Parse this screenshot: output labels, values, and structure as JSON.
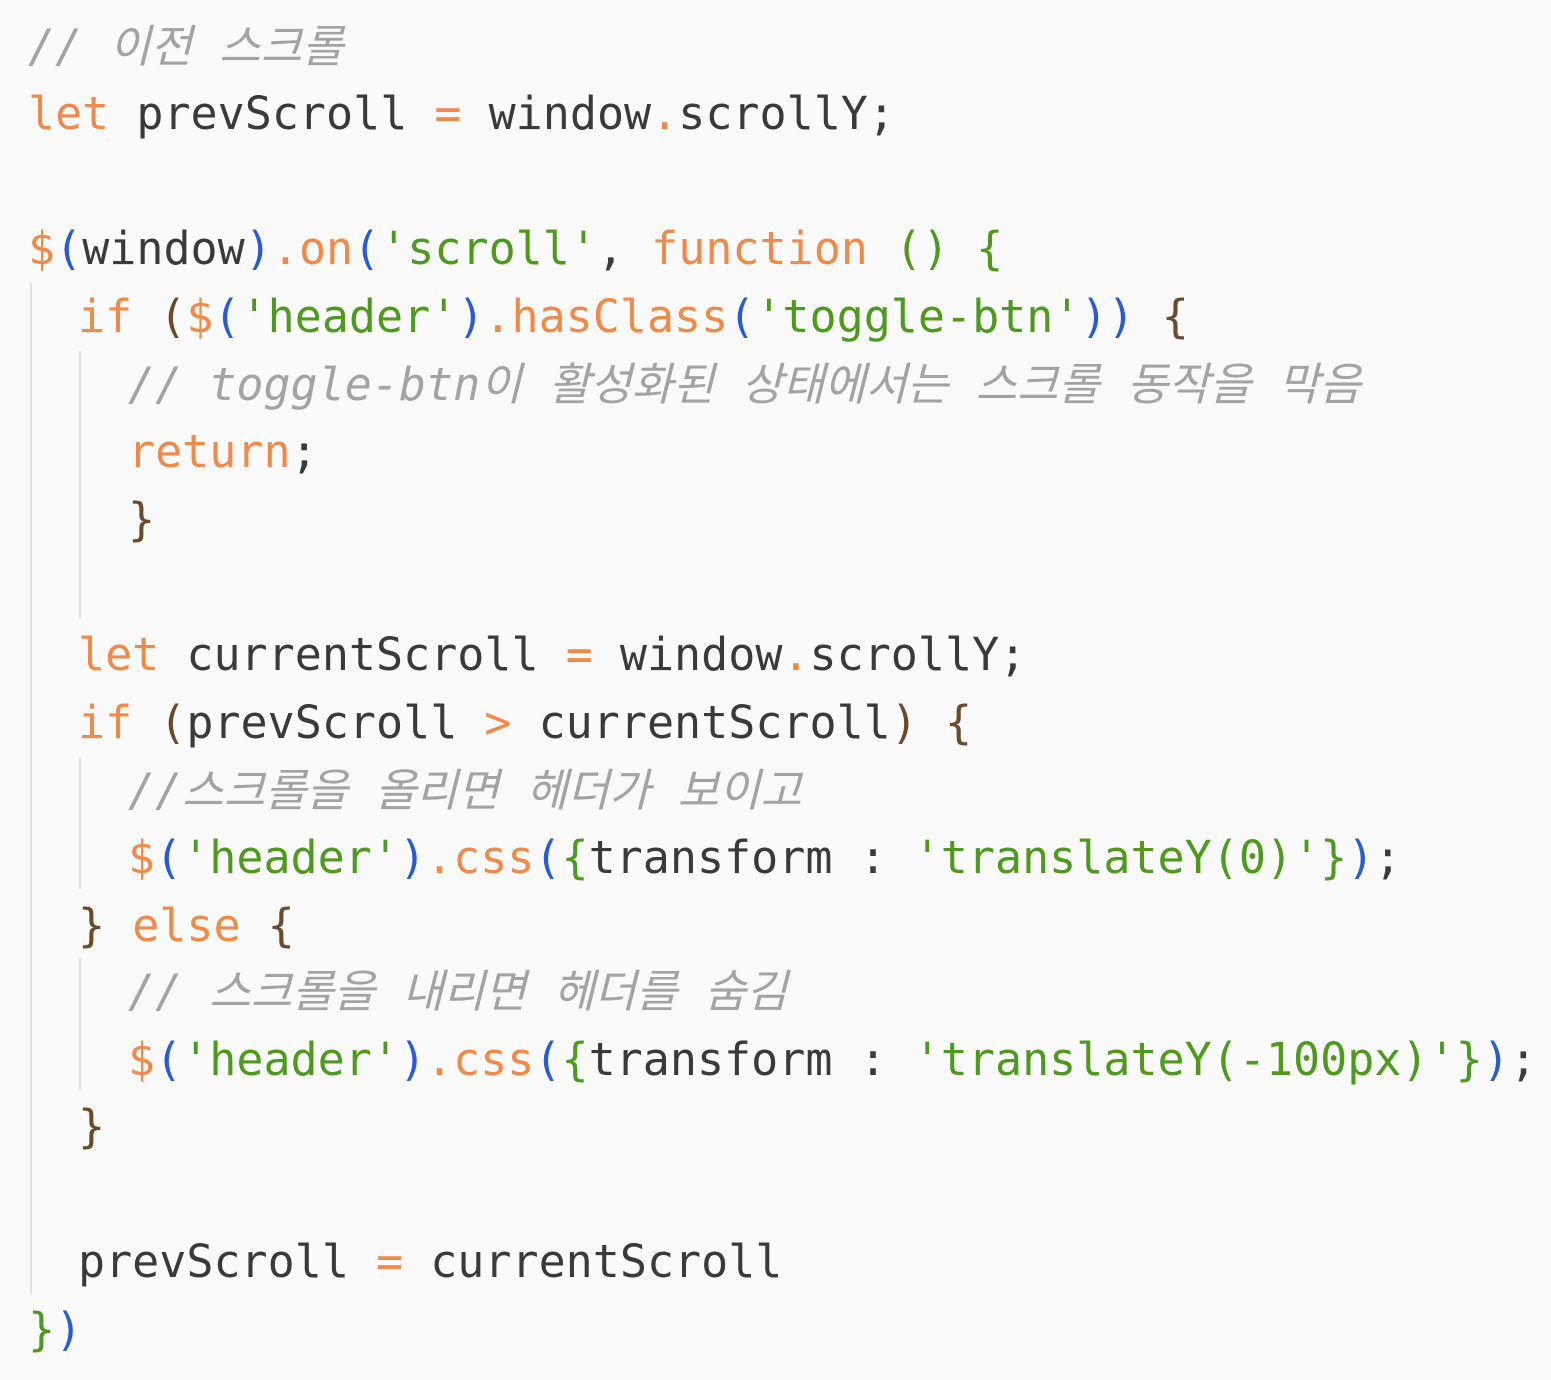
{
  "lines": [
    {
      "indent": 0,
      "tokens": [
        {
          "t": "// 이전 스크롤",
          "c": "comment"
        }
      ]
    },
    {
      "indent": 0,
      "tokens": [
        {
          "t": "let",
          "c": "keyword"
        },
        {
          "t": " prevScroll ",
          "c": "ident"
        },
        {
          "t": "=",
          "c": "op"
        },
        {
          "t": " window",
          "c": "ident"
        },
        {
          "t": ".",
          "c": "op"
        },
        {
          "t": "scrollY",
          "c": "ident"
        },
        {
          "t": ";",
          "c": "punct"
        }
      ]
    },
    {
      "indent": 0,
      "tokens": []
    },
    {
      "indent": 0,
      "tokens": [
        {
          "t": "$",
          "c": "dollar"
        },
        {
          "t": "(",
          "c": "paren-blue"
        },
        {
          "t": "window",
          "c": "ident"
        },
        {
          "t": ")",
          "c": "paren-blue"
        },
        {
          "t": ".",
          "c": "op"
        },
        {
          "t": "on",
          "c": "method"
        },
        {
          "t": "(",
          "c": "paren-blue"
        },
        {
          "t": "'scroll'",
          "c": "string"
        },
        {
          "t": ", ",
          "c": "punct"
        },
        {
          "t": "function",
          "c": "keyword"
        },
        {
          "t": " ",
          "c": "ident"
        },
        {
          "t": "()",
          "c": "string"
        },
        {
          "t": " ",
          "c": "ident"
        },
        {
          "t": "{",
          "c": "string"
        }
      ]
    },
    {
      "indent": 1,
      "tokens": [
        {
          "t": "if",
          "c": "keyword"
        },
        {
          "t": " ",
          "c": "ident"
        },
        {
          "t": "(",
          "c": "brace"
        },
        {
          "t": "$",
          "c": "dollar"
        },
        {
          "t": "(",
          "c": "paren-blue"
        },
        {
          "t": "'header'",
          "c": "string"
        },
        {
          "t": ")",
          "c": "paren-blue"
        },
        {
          "t": ".",
          "c": "op"
        },
        {
          "t": "hasClass",
          "c": "method"
        },
        {
          "t": "(",
          "c": "paren-blue"
        },
        {
          "t": "'toggle-btn'",
          "c": "string"
        },
        {
          "t": "))",
          "c": "paren-blue"
        },
        {
          "t": " ",
          "c": "ident"
        },
        {
          "t": "{",
          "c": "brace"
        }
      ]
    },
    {
      "indent": 2,
      "tokens": [
        {
          "t": "// toggle-btn이 활성화된 상태에서는 스크롤 동작을 막음",
          "c": "comment"
        }
      ]
    },
    {
      "indent": 2,
      "tokens": [
        {
          "t": "return",
          "c": "keyword"
        },
        {
          "t": ";",
          "c": "punct"
        }
      ]
    },
    {
      "indent": 2,
      "tokens": [
        {
          "t": "}",
          "c": "brace"
        }
      ]
    },
    {
      "indent": 0,
      "tokens": []
    },
    {
      "indent": 1,
      "tokens": [
        {
          "t": "let",
          "c": "keyword"
        },
        {
          "t": " currentScroll ",
          "c": "ident"
        },
        {
          "t": "=",
          "c": "op"
        },
        {
          "t": " window",
          "c": "ident"
        },
        {
          "t": ".",
          "c": "op"
        },
        {
          "t": "scrollY",
          "c": "ident"
        },
        {
          "t": ";",
          "c": "punct"
        }
      ]
    },
    {
      "indent": 1,
      "tokens": [
        {
          "t": "if",
          "c": "keyword"
        },
        {
          "t": " ",
          "c": "ident"
        },
        {
          "t": "(",
          "c": "brace"
        },
        {
          "t": "prevScroll ",
          "c": "ident"
        },
        {
          "t": ">",
          "c": "op"
        },
        {
          "t": " currentScroll",
          "c": "ident"
        },
        {
          "t": ")",
          "c": "brace"
        },
        {
          "t": " ",
          "c": "ident"
        },
        {
          "t": "{",
          "c": "brace"
        }
      ]
    },
    {
      "indent": 2,
      "tokens": [
        {
          "t": "//스크롤을 올리면 헤더가 보이고",
          "c": "comment"
        }
      ]
    },
    {
      "indent": 2,
      "tokens": [
        {
          "t": "$",
          "c": "dollar"
        },
        {
          "t": "(",
          "c": "paren-blue"
        },
        {
          "t": "'header'",
          "c": "string"
        },
        {
          "t": ")",
          "c": "paren-blue"
        },
        {
          "t": ".",
          "c": "op"
        },
        {
          "t": "css",
          "c": "method"
        },
        {
          "t": "(",
          "c": "paren-blue"
        },
        {
          "t": "{",
          "c": "string"
        },
        {
          "t": "transform ",
          "c": "ident"
        },
        {
          "t": ": ",
          "c": "punct"
        },
        {
          "t": "'translateY(0)'",
          "c": "string"
        },
        {
          "t": "}",
          "c": "string"
        },
        {
          "t": ")",
          "c": "paren-blue"
        },
        {
          "t": ";",
          "c": "punct"
        }
      ]
    },
    {
      "indent": 1,
      "tokens": [
        {
          "t": "}",
          "c": "brace"
        },
        {
          "t": " ",
          "c": "ident"
        },
        {
          "t": "else",
          "c": "keyword"
        },
        {
          "t": " ",
          "c": "ident"
        },
        {
          "t": "{",
          "c": "brace"
        }
      ]
    },
    {
      "indent": 2,
      "tokens": [
        {
          "t": "// 스크롤을 내리면 헤더를 숨김",
          "c": "comment"
        }
      ]
    },
    {
      "indent": 2,
      "tokens": [
        {
          "t": "$",
          "c": "dollar"
        },
        {
          "t": "(",
          "c": "paren-blue"
        },
        {
          "t": "'header'",
          "c": "string"
        },
        {
          "t": ")",
          "c": "paren-blue"
        },
        {
          "t": ".",
          "c": "op"
        },
        {
          "t": "css",
          "c": "method"
        },
        {
          "t": "(",
          "c": "paren-blue"
        },
        {
          "t": "{",
          "c": "string"
        },
        {
          "t": "transform ",
          "c": "ident"
        },
        {
          "t": ": ",
          "c": "punct"
        },
        {
          "t": "'translateY(-100px)'",
          "c": "string"
        },
        {
          "t": "}",
          "c": "string"
        },
        {
          "t": ")",
          "c": "paren-blue"
        },
        {
          "t": ";",
          "c": "punct"
        }
      ]
    },
    {
      "indent": 1,
      "tokens": [
        {
          "t": "}",
          "c": "brace"
        }
      ]
    },
    {
      "indent": 0,
      "tokens": []
    },
    {
      "indent": 1,
      "tokens": [
        {
          "t": "prevScroll ",
          "c": "ident"
        },
        {
          "t": "=",
          "c": "op"
        },
        {
          "t": " currentScroll",
          "c": "ident"
        }
      ]
    },
    {
      "indent": 0,
      "tokens": [
        {
          "t": "}",
          "c": "string"
        },
        {
          "t": ")",
          "c": "paren-blue"
        }
      ]
    }
  ]
}
